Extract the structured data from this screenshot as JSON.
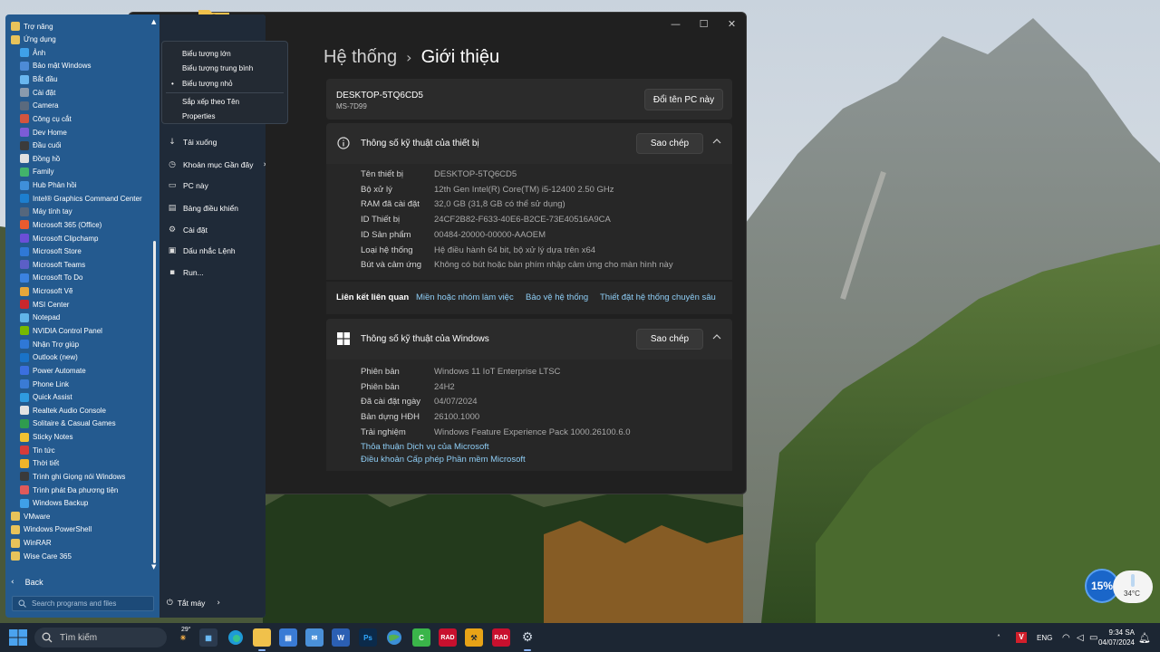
{
  "settings": {
    "breadcrumb_parent": "Hệ thống",
    "breadcrumb_current": "Giới thiệu",
    "pc_name": "DESKTOP-5TQ6CD5",
    "pc_model": "MS-7D99",
    "rename_label": "Đổi tên PC này",
    "device_specs": {
      "title": "Thông số kỹ thuật của thiết bị",
      "copy_label": "Sao chép",
      "rows": [
        {
          "k": "Tên thiết bị",
          "v": "DESKTOP-5TQ6CD5"
        },
        {
          "k": "Bộ xử lý",
          "v": "12th Gen Intel(R) Core(TM) i5-12400   2.50 GHz"
        },
        {
          "k": "RAM đã cài đặt",
          "v": "32,0 GB (31,8 GB có thể sử dụng)"
        },
        {
          "k": "ID Thiết bị",
          "v": "24CF2B82-F633-40E6-B2CE-73E40516A9CA"
        },
        {
          "k": "ID Sản phẩm",
          "v": "00484-20000-00000-AAOEM"
        },
        {
          "k": "Loại hệ thống",
          "v": "Hệ điều hành 64 bit, bộ xử lý dựa trên x64"
        },
        {
          "k": "Bút và cảm ứng",
          "v": "Không có bút hoặc bàn phím nhập cảm ứng cho màn hình này"
        }
      ]
    },
    "related": {
      "label": "Liên kết liên quan",
      "links": [
        "Miền hoặc nhóm làm việc",
        "Bảo vệ hệ thống",
        "Thiết đặt hệ thống chuyên sâu"
      ]
    },
    "windows_specs": {
      "title": "Thông số kỹ thuật của Windows",
      "copy_label": "Sao chép",
      "rows": [
        {
          "k": "Phiên bản",
          "v": "Windows 11 IoT Enterprise LTSC"
        },
        {
          "k": "Phiên bản",
          "v": "24H2"
        },
        {
          "k": "Đã cài đặt ngày",
          "v": "04/07/2024"
        },
        {
          "k": "Bản dựng HĐH",
          "v": "26100.1000"
        },
        {
          "k": "Trải nghiệm",
          "v": "Windows Feature Experience Pack 1000.26100.6.0"
        }
      ],
      "link_service": "Thỏa thuận Dịch vụ của Microsoft",
      "link_license": "Điều khoản Cấp phép Phần mềm Microsoft"
    }
  },
  "start_menu": {
    "items": [
      {
        "label": "Trợ năng",
        "type": "folder",
        "color": "#e8c35a"
      },
      {
        "label": "Ứng dụng",
        "type": "folder",
        "color": "#e8c35a"
      },
      {
        "label": "Ảnh",
        "type": "app",
        "color": "#3fa0e8"
      },
      {
        "label": "Bảo mật Windows",
        "type": "app",
        "color": "#4d8bd6"
      },
      {
        "label": "Bắt đầu",
        "type": "app",
        "color": "#69b7f0"
      },
      {
        "label": "Cài đặt",
        "type": "app",
        "color": "#8a9aad"
      },
      {
        "label": "Camera",
        "type": "app",
        "color": "#5a6a7e"
      },
      {
        "label": "Công cụ cắt",
        "type": "app",
        "color": "#d2553f"
      },
      {
        "label": "Dev Home",
        "type": "app",
        "color": "#7b5cd6"
      },
      {
        "label": "Đầu cuối",
        "type": "app",
        "color": "#3b3b3b"
      },
      {
        "label": "Đồng hồ",
        "type": "app",
        "color": "#e0e0e0"
      },
      {
        "label": "Family",
        "type": "app",
        "color": "#42b36b"
      },
      {
        "label": "Hub Phản hồi",
        "type": "app",
        "color": "#3f8fd9"
      },
      {
        "label": "Intel® Graphics Command Center",
        "type": "app",
        "color": "#1d7fcf"
      },
      {
        "label": "Máy tính tay",
        "type": "app",
        "color": "#55677d"
      },
      {
        "label": "Microsoft 365 (Office)",
        "type": "app",
        "color": "#e95b2f"
      },
      {
        "label": "Microsoft Clipchamp",
        "type": "app",
        "color": "#6b4fd8"
      },
      {
        "label": "Microsoft Store",
        "type": "app",
        "color": "#2f78d6"
      },
      {
        "label": "Microsoft Teams",
        "type": "app",
        "color": "#5b5fc7"
      },
      {
        "label": "Microsoft To Do",
        "type": "app",
        "color": "#3b82e0"
      },
      {
        "label": "Microsoft Vẽ",
        "type": "app",
        "color": "#e6a63a"
      },
      {
        "label": "MSI Center",
        "type": "app",
        "color": "#c9282d"
      },
      {
        "label": "Notepad",
        "type": "app",
        "color": "#61b5e8"
      },
      {
        "label": "NVIDIA Control Panel",
        "type": "app",
        "color": "#76b900"
      },
      {
        "label": "Nhận Trợ giúp",
        "type": "app",
        "color": "#2f78d6"
      },
      {
        "label": "Outlook (new)",
        "type": "app",
        "color": "#1a73c8"
      },
      {
        "label": "Power Automate",
        "type": "app",
        "color": "#3b6fe0"
      },
      {
        "label": "Phone Link",
        "type": "app",
        "color": "#3a7bd5"
      },
      {
        "label": "Quick Assist",
        "type": "app",
        "color": "#2f9be0"
      },
      {
        "label": "Realtek Audio Console",
        "type": "app",
        "color": "#e2e2e2"
      },
      {
        "label": "Solitaire & Casual Games",
        "type": "app",
        "color": "#2f9c4e"
      },
      {
        "label": "Sticky Notes",
        "type": "app",
        "color": "#f1c232"
      },
      {
        "label": "Tin tức",
        "type": "app",
        "color": "#d63b3b"
      },
      {
        "label": "Thời tiết",
        "type": "app",
        "color": "#f0b429"
      },
      {
        "label": "Trình ghi Giọng nói Windows",
        "type": "app",
        "color": "#3a3a3a"
      },
      {
        "label": "Trình phát Đa phương tiện",
        "type": "app",
        "color": "#e05a5a"
      },
      {
        "label": "Windows Backup",
        "type": "app",
        "color": "#3fa0e8"
      },
      {
        "label": "VMware",
        "type": "folder",
        "color": "#e8c35a"
      },
      {
        "label": "Windows PowerShell",
        "type": "folder",
        "color": "#e8c35a"
      },
      {
        "label": "WinRAR",
        "type": "folder",
        "color": "#e8c35a"
      },
      {
        "label": "Wise Care 365",
        "type": "folder",
        "color": "#e8c35a"
      }
    ],
    "back_label": "Back",
    "search_placeholder": "Search programs and files",
    "right_items": [
      {
        "label": "Tải xuống",
        "icon": "download-icon",
        "glyph": "↓"
      },
      {
        "label": "Khoản mục Gần đây",
        "icon": "recent-icon",
        "glyph": "◷"
      },
      {
        "label": "PC này",
        "icon": "pc-icon",
        "glyph": "▭"
      },
      {
        "label": "Bảng điều khiển",
        "icon": "control-panel-icon",
        "glyph": "▤"
      },
      {
        "label": "Cài đặt",
        "icon": "gear-icon",
        "glyph": "⚙"
      },
      {
        "label": "Dấu nhắc Lệnh",
        "icon": "cmd-icon",
        "glyph": "▣"
      },
      {
        "label": "Run...",
        "icon": "run-icon",
        "glyph": "▪"
      }
    ],
    "shutdown_label": "Tắt máy"
  },
  "context_menu": {
    "items": [
      "Biểu tượng lớn",
      "Biểu tượng trung bình",
      "Biểu tượng nhỏ",
      "Sắp xếp theo Tên",
      "Properties"
    ],
    "selected": "Biểu tượng nhỏ"
  },
  "widget": {
    "battery_percent": "15%",
    "temperature": "34°C"
  },
  "taskbar": {
    "search_label": "Tìm kiếm",
    "weather_temp": "29°",
    "language": "ENG",
    "time": "9:34 SA",
    "date": "04/07/2024",
    "rad1": "RAD",
    "rad2": "RAD"
  }
}
